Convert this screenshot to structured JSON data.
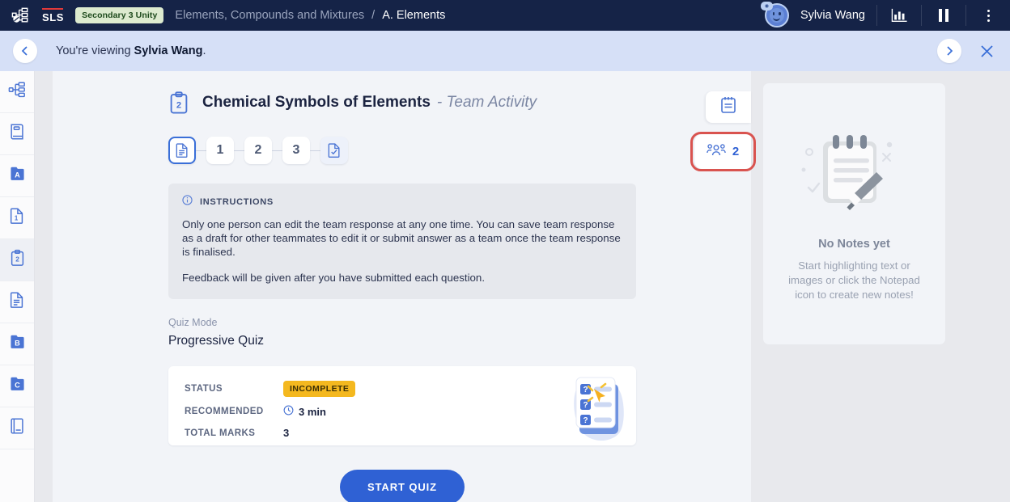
{
  "header": {
    "app_icon": "sitemap-app-icon",
    "logo_text": "SLS",
    "class_badge": "Secondary 3 Unity",
    "breadcrumb_parent": "Elements, Compounds and Mixtures",
    "breadcrumb_sep": "/",
    "breadcrumb_current": "A. Elements",
    "user_name": "Sylvia Wang",
    "icons": [
      "chart-bar-icon",
      "pause-icon",
      "kebab-menu-icon"
    ]
  },
  "viewing_banner": {
    "prefix": "You're viewing ",
    "name": "Sylvia Wang",
    "suffix": ".",
    "back_icon": "chevron-left-icon",
    "next_icon": "chevron-right-icon",
    "close_icon": "close-icon"
  },
  "sidebar": {
    "items": [
      {
        "name": "sidebar-item-overview",
        "icon": "sitemap-icon",
        "active": false
      },
      {
        "name": "sidebar-item-book",
        "icon": "book-icon",
        "active": false
      },
      {
        "name": "sidebar-item-section-a",
        "icon": "folder-a-icon",
        "label": "A",
        "active": false
      },
      {
        "name": "sidebar-item-page-1",
        "icon": "page-1-icon",
        "label": "1",
        "active": false
      },
      {
        "name": "sidebar-item-page-2",
        "icon": "clipboard-2-icon",
        "label": "2",
        "active": true
      },
      {
        "name": "sidebar-item-document",
        "icon": "document-icon",
        "active": false
      },
      {
        "name": "sidebar-item-section-b",
        "icon": "folder-b-icon",
        "label": "B",
        "active": false
      },
      {
        "name": "sidebar-item-section-c",
        "icon": "folder-c-icon",
        "label": "C",
        "active": false
      },
      {
        "name": "sidebar-item-notebook",
        "icon": "notebook-icon",
        "active": false
      }
    ]
  },
  "activity": {
    "icon": "clipboard-2-icon",
    "title": "Chemical Symbols of Elements",
    "subtitle": "- Team Activity",
    "steps": [
      {
        "name": "step-overview",
        "label": "",
        "icon": "document-icon",
        "state": "current"
      },
      {
        "name": "step-1",
        "label": "1",
        "state": "default"
      },
      {
        "name": "step-2",
        "label": "2",
        "state": "default"
      },
      {
        "name": "step-3",
        "label": "3",
        "state": "default"
      },
      {
        "name": "step-review",
        "label": "",
        "icon": "checklist-icon",
        "state": "review"
      }
    ],
    "instructions": {
      "icon": "info-icon",
      "label": "INSTRUCTIONS",
      "paragraphs": [
        "Only one person can edit the team response at any one time. You can save team response as a draft for other teammates to edit it or submit answer as a team once the team response is finalised.",
        "Feedback will be given after you have submitted each question."
      ]
    },
    "quiz_mode_label": "Quiz Mode",
    "quiz_mode_value": "Progressive Quiz",
    "stats": [
      {
        "key": "STATUS",
        "value": "INCOMPLETE",
        "type": "pill"
      },
      {
        "key": "RECOMMENDED",
        "value": "3 min",
        "type": "time"
      },
      {
        "key": "TOTAL MARKS",
        "value": "3",
        "type": "text"
      }
    ],
    "illustration": "quiz-questions-illustration",
    "start_button": "START QUIZ"
  },
  "tools": {
    "notepad_icon": "notepad-icon",
    "members_icon": "members-group-icon",
    "members_count": "2"
  },
  "notes_panel": {
    "illustration": "notepad-highlighter-illustration",
    "title": "No Notes yet",
    "subtitle": "Start highlighting text or images or click the Notepad icon to create new notes!"
  },
  "colors": {
    "header_bg": "#152347",
    "banner_bg": "#d6e0f7",
    "accent_blue": "#2f61d4",
    "pill_amber": "#f4b81f",
    "highlight_red": "#d9534f",
    "class_badge_bg": "#dceacf"
  }
}
